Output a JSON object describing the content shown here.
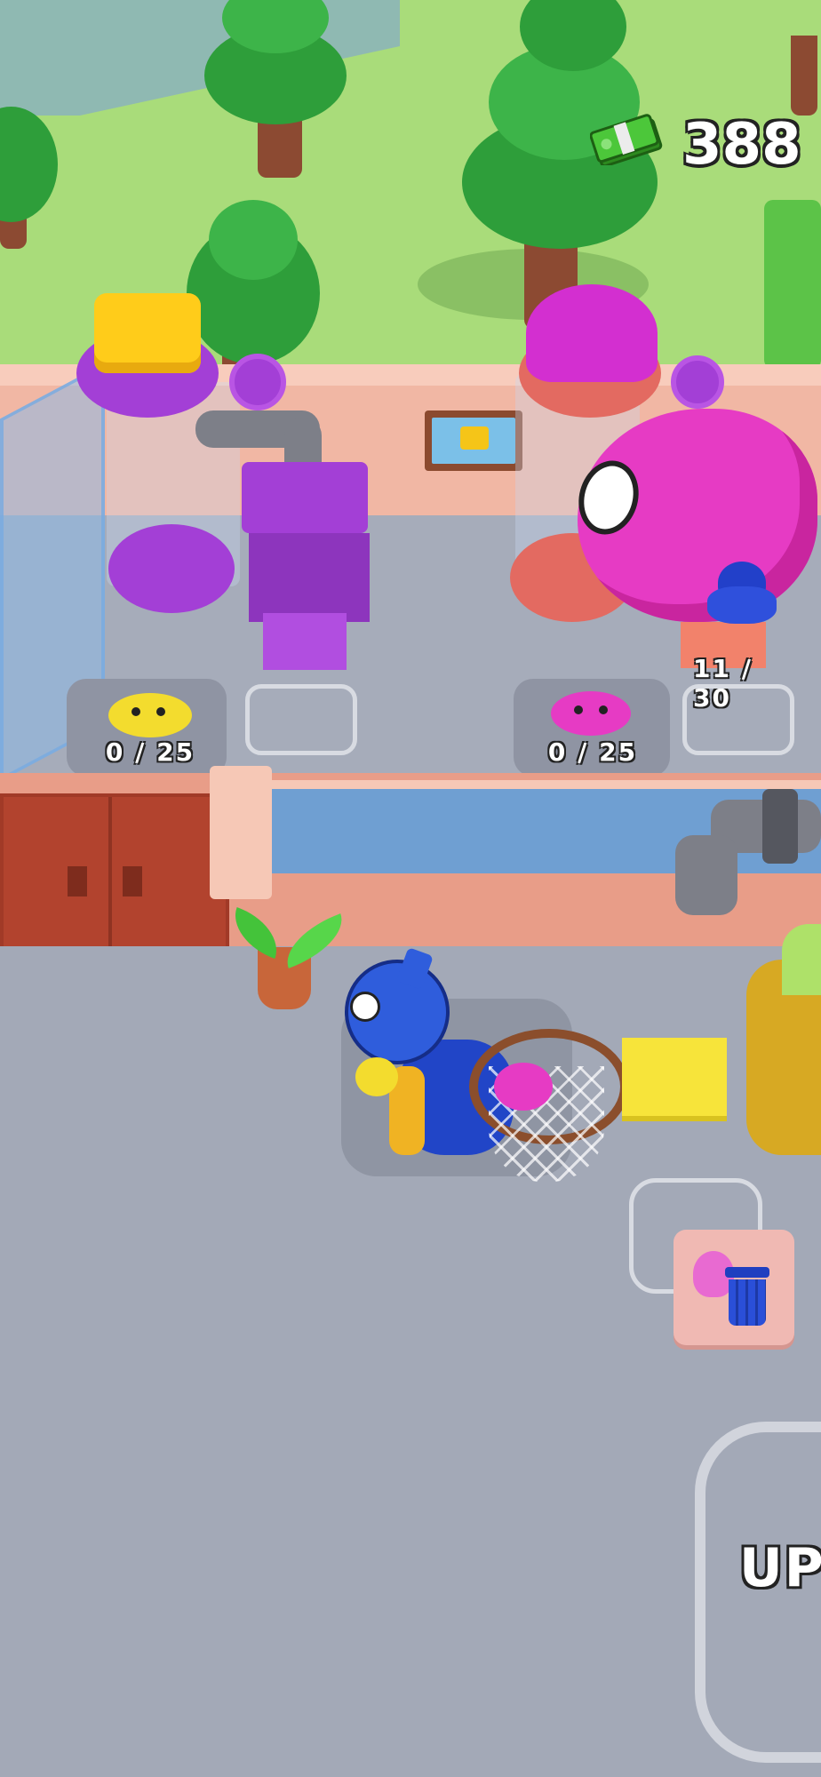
{
  "hud": {
    "cash_amount": "388",
    "cash_icon": "cash-bundle-icon"
  },
  "stations": [
    {
      "name": "yellow-slime-station",
      "counter": "0 / 25",
      "slime_color": "#f3dc2e"
    },
    {
      "name": "pink-slime-station",
      "counter": "0 / 25",
      "slime_color": "#e63bc4"
    }
  ],
  "blue_creature_station": {
    "counter": "11 / 30",
    "icon": "blue-creature-icon"
  },
  "trash_button": {
    "icon": "trash-can-icon"
  },
  "upgrade_zone": {
    "label": "UPG"
  },
  "colors": {
    "accent_purple": "#a33fd6",
    "accent_pink": "#e63bc4",
    "accent_yellow": "#ffcc1a",
    "floor": "#a3a9b7",
    "grass": "#a9dc7a"
  }
}
